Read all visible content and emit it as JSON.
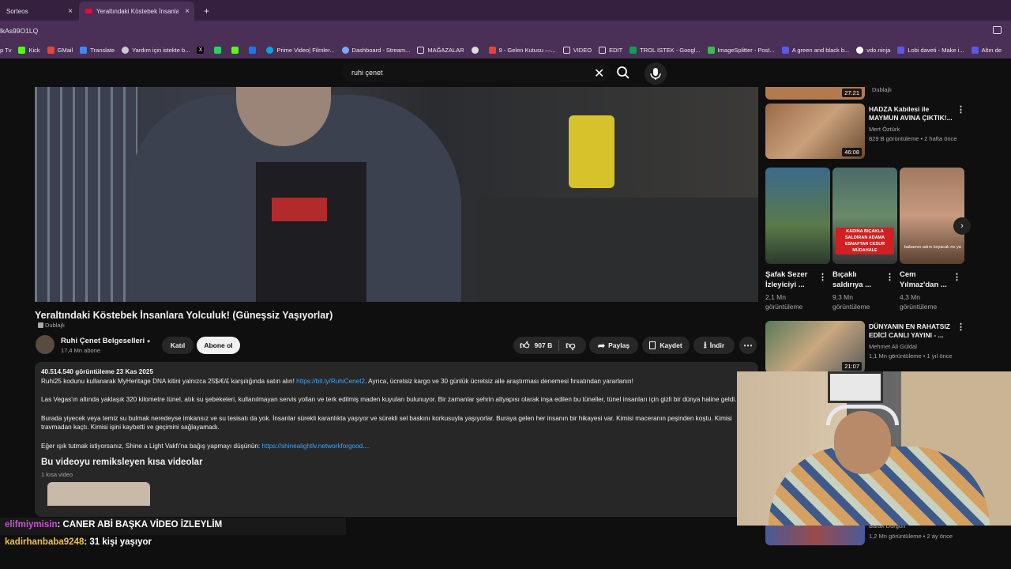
{
  "browser": {
    "tabs": [
      {
        "label": "Sorteos",
        "close": "×"
      },
      {
        "label": "Yeraltındaki Köstebek İnsanlara",
        "close": "×"
      }
    ],
    "new_tab": "+",
    "address": "lkAs99O1LQ",
    "bookmarks": [
      "p Tv",
      "Kick",
      "GMail",
      "Translate",
      "Yardım için istekte b...",
      "Prime Video| Filmler...",
      "Dashboard - Stream...",
      "MAĞAZALAR",
      "9 - Gelen Kutusu —...",
      "VIDEO",
      "EDIT",
      "TROL ISTEK - Googl...",
      "ImageSplitter - Post...",
      "A green and black b...",
      "vdo.ninja",
      "Lobi daveti - Make i...",
      "Altın de"
    ]
  },
  "search": {
    "value": "ruhi çenet"
  },
  "video": {
    "title": "Yeraltındaki Köstebek İnsanlara Yolculuk! (Güneşsiz Yaşıyorlar)",
    "dubbed": "Dublajlı",
    "channel": "Ruhi Çenet Belgeselleri",
    "subscribers": "17,4 Mn abone",
    "join": "Katıl",
    "subscribe": "Abone ol",
    "likes": "907 B",
    "share": "Paylaş",
    "save": "Kaydet",
    "download": "İndir"
  },
  "description": {
    "stats": "40.514.540 görüntüleme  23 Kas 2025",
    "line1_text": "Ruhi25 kodunu kullanarak MyHeritage DNA kitini yalnızca 25$/€/£ karşılığında satın alın! ",
    "line1_link": "https://bit.ly/RuhiCenet2",
    "line1_rest": ". Ayrıca, ücretsiz kargo ve 30 günlük ücretsiz aile araştırması denemesi fırsatından yararlanın!",
    "para2": "Las Vegas'ın altında yaklaşık 320 kilometre tünel, atık su şebekeleri, kullanılmayan servis yolları ve terk edilmiş maden kuyuları bulunuyor. Bir zamanlar şehrin altyapısı olarak inşa edilen bu tüneller, tünel insanları için gizli bir dünya haline geldi.",
    "para3": "Burada yiyecek veya temiz su bulmak neredeyse imkansız ve su tesisatı da yok. İnsanlar sürekli karanlıkta yaşıyor ve sürekli sel baskını korkusuyla yaşıyorlar. Buraya gelen her insanın bir hikayesi var. Kimisi maceranın peşinden koştu. Kimisi travmadan kaçtı. Kimisi işini kaybetti ve geçimini sağlayamadı.",
    "para4_text": "Eğer ışık tutmak istiyorsanız, Shine a Light Vakfı'na bağış yapmayı düşünün: ",
    "para4_link": "https://shinealightlv.networkforgood....",
    "shorts_heading": "Bu videoyu remiksleyen kısa videolar",
    "shorts_count": "1 kısa video"
  },
  "sidebar": {
    "top_partial": {
      "duration": "27:21",
      "meta": "Dublajlı"
    },
    "item1": {
      "title": "HADZA Kabilesi ile MAYMUN AVINA ÇIKTIK!...",
      "channel": "Mert Öztürk",
      "meta": "829 B görüntüleme • 2 hafta önce",
      "duration": "46:08"
    },
    "shorts": [
      {
        "title": "Şafak Sezer İzleyiciyi ...",
        "views": "2,1 Mn",
        "label": "görüntüleme"
      },
      {
        "title": "Bıçaklı saldırıya ...",
        "views": "9,3 Mn",
        "label": "görüntüleme",
        "overlay": "KADINA BIÇAKLA SALDIRAN ADAMA ESNAFTAN CESUR MÜDAHALE"
      },
      {
        "title": "Cem Yılmaz'dan ...",
        "views": "4,3 Mn",
        "label": "görüntüleme",
        "caption": "babamın adını koyacak mı ya"
      }
    ],
    "item2": {
      "title": "DÜNYANIN EN RAHATSIZ EDİCİ CANLI YAYINI - ...",
      "channel": "Mehmet Ali Güldal",
      "meta": "1,1 Mn görüntüleme • 1 yıl önce",
      "duration": "21:07"
    },
    "item3": {
      "channel": "Barak Durgun",
      "meta": "1,2 Mn görüntüleme • 2 ay önce"
    }
  },
  "chat": [
    {
      "user": "elifmiymisin",
      "message": ": CANER ABİ BAŞKA VİDEO İZLEYLİM"
    },
    {
      "user": "kadirhanbaba9248",
      "message": ": 31 kişi yaşıyor"
    }
  ],
  "colors": {
    "accent_link": "#3ea6ff",
    "chrome": "#4a2f57",
    "chat_user1": "#c94fd6",
    "chat_user2": "#f0c040"
  }
}
